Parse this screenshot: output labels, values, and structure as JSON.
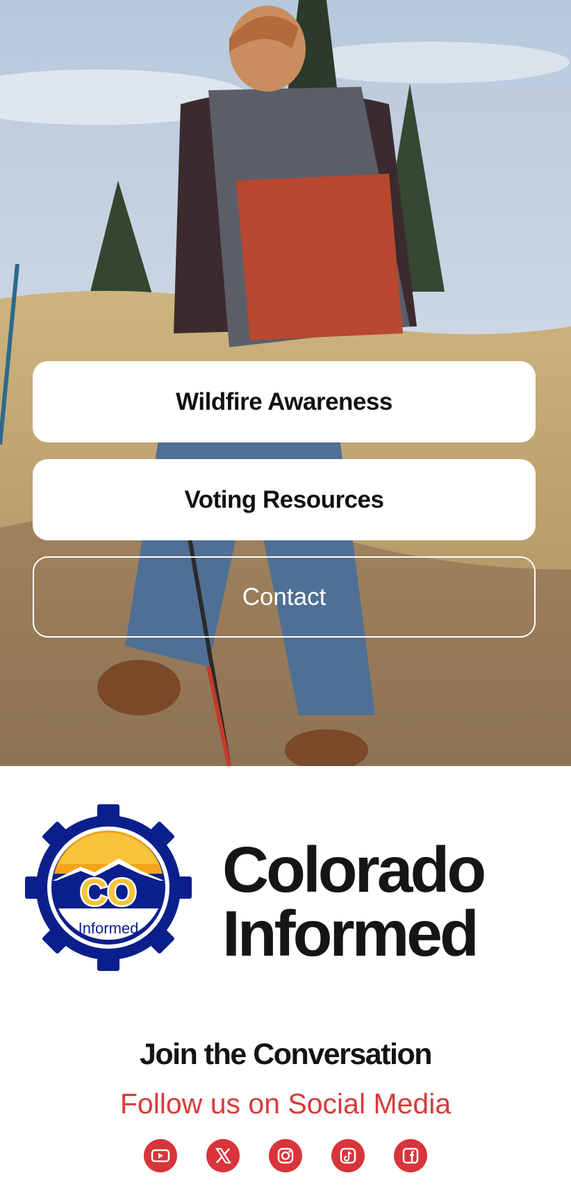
{
  "hero": {
    "buttons": [
      {
        "label": "Wildfire Awareness"
      },
      {
        "label": "Voting Resources"
      },
      {
        "label": "Contact"
      }
    ]
  },
  "brand": {
    "logo_text": "CO",
    "logo_subtext": "Informed",
    "name_line1": "Colorado",
    "name_line2": "Informed"
  },
  "social": {
    "title": "Join the Conversation",
    "subtitle": "Follow us on Social Media",
    "icons": [
      "youtube-icon",
      "x-icon",
      "instagram-icon",
      "tiktok-icon",
      "facebook-icon"
    ],
    "icon_color": "#d8343a"
  },
  "colors": {
    "accent": "#d93a3a",
    "logo_navy": "#0b1f8c",
    "logo_gold": "#f2a51a"
  }
}
